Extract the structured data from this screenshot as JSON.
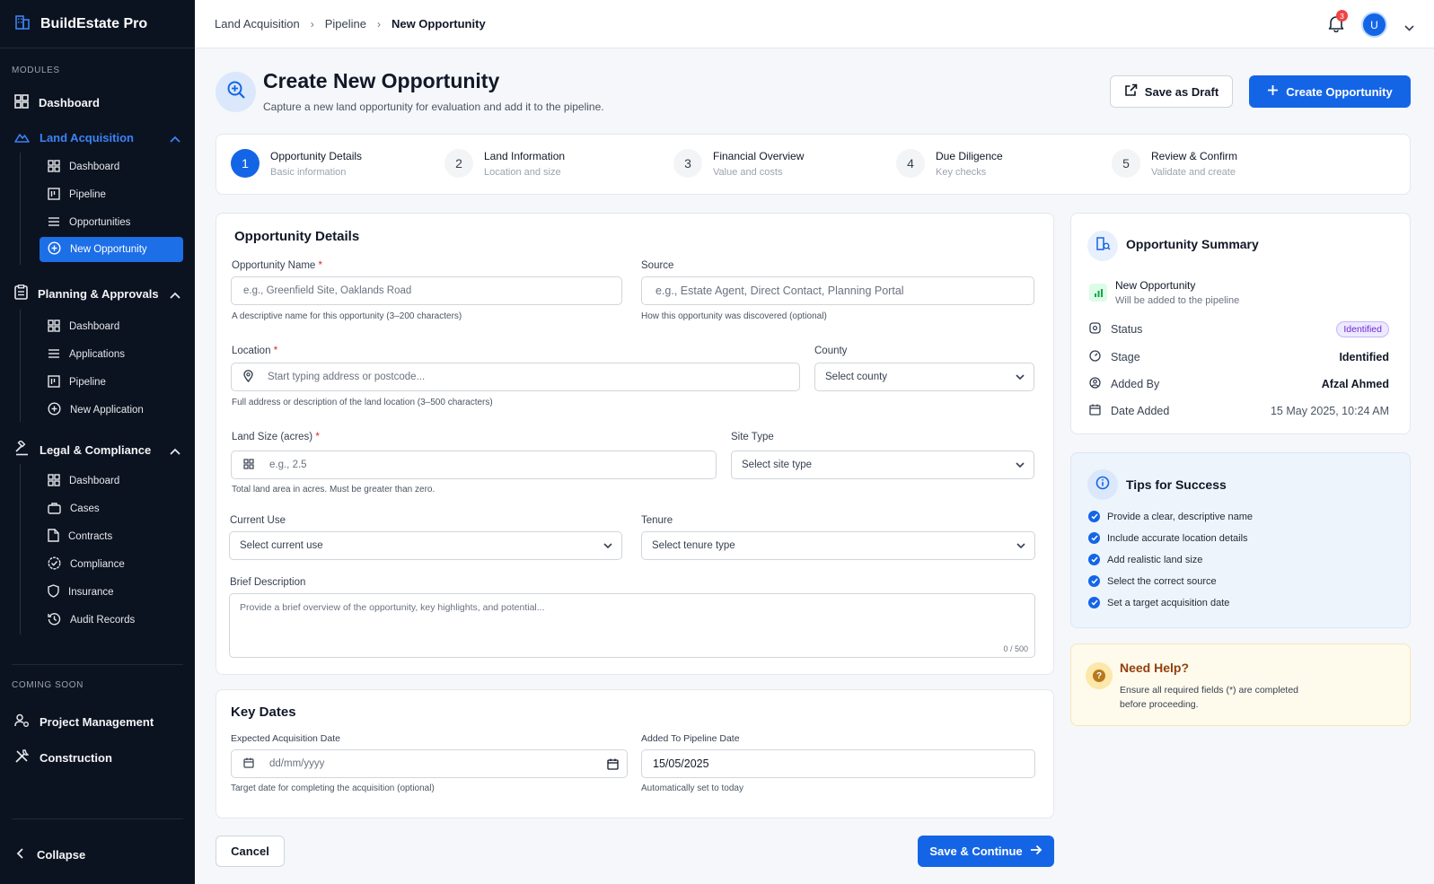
{
  "app": {
    "name": "BuildEstate Pro"
  },
  "sidebar": {
    "modules_label": "MODULES",
    "dashboard": "Dashboard",
    "land_acquisition": {
      "label": "Land Acquisition",
      "items": [
        "Dashboard",
        "Pipeline",
        "Opportunities",
        "New Opportunity"
      ]
    },
    "planning": {
      "label": "Planning & Approvals",
      "items": [
        "Dashboard",
        "Applications",
        "Pipeline",
        "New Application"
      ]
    },
    "legal": {
      "label": "Legal & Compliance",
      "items": [
        "Dashboard",
        "Cases",
        "Contracts",
        "Compliance",
        "Insurance",
        "Audit Records"
      ]
    },
    "coming_soon_label": "COMING SOON",
    "project_management": "Project Management",
    "construction": "Construction",
    "collapse": "Collapse"
  },
  "header": {
    "breadcrumb": [
      "Land Acquisition",
      "Pipeline",
      "New Opportunity"
    ],
    "notification_count": "3",
    "avatar_initial": "U"
  },
  "page": {
    "title": "Create New Opportunity",
    "subtitle": "Capture a new land opportunity for evaluation and add it to the pipeline.",
    "save_draft": "Save as Draft",
    "create": "Create Opportunity"
  },
  "steps": [
    {
      "num": "1",
      "title": "Opportunity Details",
      "sub": "Basic information"
    },
    {
      "num": "2",
      "title": "Land Information",
      "sub": "Location and size"
    },
    {
      "num": "3",
      "title": "Financial Overview",
      "sub": "Value and costs"
    },
    {
      "num": "4",
      "title": "Due Diligence",
      "sub": "Key checks"
    },
    {
      "num": "5",
      "title": "Review & Confirm",
      "sub": "Validate and create"
    }
  ],
  "form": {
    "section_title": "Opportunity Details",
    "name_label": "Opportunity Name",
    "name_placeholder": "e.g., Greenfield Site, Oaklands Road",
    "name_hint": "A descriptive name for this opportunity (3–200 characters)",
    "source_label": "Source",
    "source_placeholder": "e.g., Estate Agent, Direct Contact, Planning Portal",
    "source_hint": "How this opportunity was discovered (optional)",
    "location_label": "Location",
    "location_placeholder": "Start typing address or postcode...",
    "location_hint": "Full address or description of the land location (3–500 characters)",
    "county_label": "County",
    "county_value": "Select county",
    "size_label": "Land Size (acres)",
    "size_placeholder": "e.g., 2.5",
    "size_hint": "Total land area in acres. Must be greater than zero.",
    "site_type_label": "Site Type",
    "site_type_value": "Select site type",
    "current_use_label": "Current Use",
    "current_use_value": "Select current use",
    "tenure_label": "Tenure",
    "tenure_value": "Select tenure type",
    "desc_label": "Brief Description",
    "desc_placeholder": "Provide a brief overview of the opportunity, key highlights, and potential...",
    "desc_count": "0 / 500"
  },
  "dates": {
    "section_title": "Key Dates",
    "expected_label": "Expected Acquisition Date",
    "expected_placeholder": "dd/mm/yyyy",
    "expected_hint": "Target date for completing the acquisition (optional)",
    "added_label": "Added To Pipeline Date",
    "added_value": "15/05/2025",
    "added_hint": "Automatically set to today"
  },
  "footer": {
    "cancel": "Cancel",
    "save_continue": "Save & Continue"
  },
  "summary": {
    "title": "Opportunity Summary",
    "item_title": "New Opportunity",
    "item_sub": "Will be added to the pipeline",
    "status_label": "Status",
    "status_value": "Identified",
    "stage_label": "Stage",
    "stage_value": "Identified",
    "added_by_label": "Added By",
    "added_by_value": "Afzal Ahmed",
    "date_label": "Date Added",
    "date_value": "15 May 2025, 10:24 AM"
  },
  "tips": {
    "title": "Tips for Success",
    "items": [
      "Provide a clear, descriptive name",
      "Include accurate location details",
      "Add realistic land size",
      "Select the correct source",
      "Set a target acquisition date"
    ]
  },
  "help": {
    "title": "Need Help?",
    "line1": "Ensure all required fields (*) are completed",
    "line2": "before proceeding."
  },
  "colors": {
    "accent": "#1465e6",
    "sidebar_bg": "#0c1320",
    "help_bg": "#fefaec"
  }
}
